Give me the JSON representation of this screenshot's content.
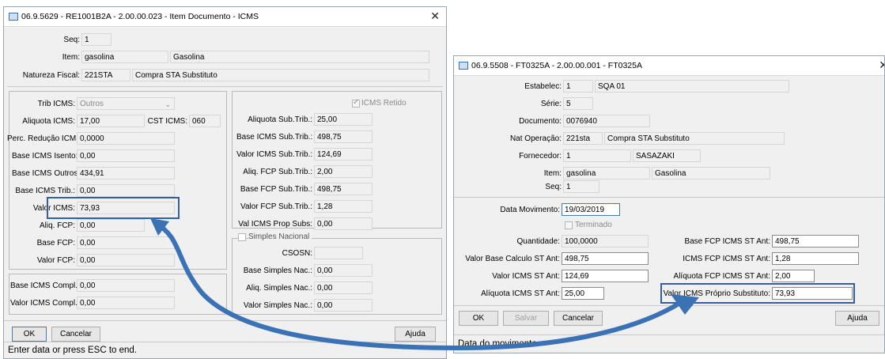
{
  "colors": {
    "window_bg": "#f0f0f0",
    "highlight": "#2e61a8",
    "arrow": "#3a72b5"
  },
  "icons": {
    "window_icon": "app-window-icon",
    "close_icon": "close-icon",
    "arrow": "curved-arrow"
  },
  "dialog1": {
    "title": "06.9.5629 - RE1001B2A - 2.00.00.023 - Item Documento - ICMS",
    "close": "✕",
    "header": {
      "seq_label": "Seq:",
      "seq_value": "1",
      "item_label": "Item:",
      "item_code": "gasolina",
      "item_desc": "Gasolina",
      "natureza_label": "Natureza Fiscal:",
      "natureza_code": "221STA",
      "natureza_desc": "Compra STA Substituto"
    },
    "left": {
      "trib_label": "Trib ICMS:",
      "trib_value": "Outros",
      "aliquota_label": "Aliquota ICMS:",
      "aliquota_value": "17,00",
      "cst_label": "CST ICMS:",
      "cst_value": "060",
      "perc_label": "Perc. Redução ICMS:",
      "perc_value": "0,0000",
      "base_isento_label": "Base ICMS Isento:",
      "base_isento_value": "0,00",
      "base_outros_label": "Base ICMS Outros:",
      "base_outros_value": "434,91",
      "base_trib_label": "Base ICMS Trib.:",
      "base_trib_value": "0,00",
      "valor_icms_label": "Valor ICMS:",
      "valor_icms_value": "73,93",
      "aliq_fcp_label": "Aliq. FCP:",
      "aliq_fcp_value": "0,00",
      "base_fcp_label": "Base FCP:",
      "base_fcp_value": "0,00",
      "valor_fcp_label": "Valor FCP:",
      "valor_fcp_value": "0,00",
      "base_compl_label": "Base ICMS Compl.:",
      "base_compl_value": "0,00",
      "valor_compl_label": "Valor ICMS Compl.:",
      "valor_compl_value": "0,00"
    },
    "right": {
      "icms_retido_label": "ICMS Retido",
      "aliq_sub_label": "Aliquota Sub.Trib.:",
      "aliq_sub_value": "25,00",
      "base_sub_label": "Base ICMS Sub.Trib.:",
      "base_sub_value": "498,75",
      "valor_sub_label": "Valor ICMS Sub.Trib.:",
      "valor_sub_value": "124,69",
      "aliq_fcp_sub_label": "Aliq. FCP Sub.Trib.:",
      "aliq_fcp_sub_value": "2,00",
      "base_fcp_sub_label": "Base FCP Sub.Trib.:",
      "base_fcp_sub_value": "498,75",
      "valor_fcp_sub_label": "Valor FCP Sub.Trib.:",
      "valor_fcp_sub_value": "1,28",
      "val_prop_label": "Val ICMS Prop Subs:",
      "val_prop_value": "0,00",
      "simples_label": "Simples Nacional",
      "csosn_label": "CSOSN:",
      "csosn_value": "",
      "base_simples_label": "Base Simples Nac.:",
      "base_simples_value": "0,00",
      "aliq_simples_label": "Aliq. Simples Nac.:",
      "aliq_simples_value": "0,00",
      "valor_simples_label": "Valor Simples Nac.:",
      "valor_simples_value": "0,00"
    },
    "buttons": {
      "ok": "OK",
      "cancel": "Cancelar",
      "help": "Ajuda"
    },
    "status": "Enter data or press ESC to end."
  },
  "dialog2": {
    "title": "06.9.5508 - FT0325A - 2.00.00.001 - FT0325A",
    "close": "✕",
    "header": {
      "estab_label": "Estabelec:",
      "estab_code": "1",
      "estab_desc": "SQA 01",
      "serie_label": "Série:",
      "serie_value": "5",
      "doc_label": "Documento:",
      "doc_value": "0076940",
      "natop_label": "Nat Operação:",
      "natop_code": "221sta",
      "natop_desc": "Compra STA Substituto",
      "forn_label": "Fornecedor:",
      "forn_code": "1",
      "forn_desc": "SASAZAKI",
      "item_label": "Item:",
      "item_code": "gasolina",
      "item_desc": "Gasolina",
      "seq_label": "Seq:",
      "seq_value": "1"
    },
    "body": {
      "data_mov_label": "Data Movimento:",
      "data_mov_value": "19/03/2019",
      "terminado_label": "Terminado",
      "qtd_label": "Quantidade:",
      "qtd_value": "100,0000",
      "vbase_label": "Valor Base Calculo ST Ant:",
      "vbase_value": "498,75",
      "vicms_label": "Valor ICMS ST Ant:",
      "vicms_value": "124,69",
      "aliq_label": "Alíquota ICMS ST Ant:",
      "aliq_value": "25,00",
      "bfcp_label": "Base FCP ICMS ST Ant:",
      "bfcp_value": "498,75",
      "ifcp_label": "ICMS FCP ICMS ST Ant:",
      "ifcp_value": "1,28",
      "afcp_label": "Alíquota FCP ICMS ST Ant:",
      "afcp_value": "2,00",
      "vproprio_label": "Valor ICMS Próprio Substituto:",
      "vproprio_value": "73,93"
    },
    "buttons": {
      "ok": "OK",
      "save": "Salvar",
      "cancel": "Cancelar",
      "help": "Ajuda"
    },
    "status": "Data do movimento"
  }
}
